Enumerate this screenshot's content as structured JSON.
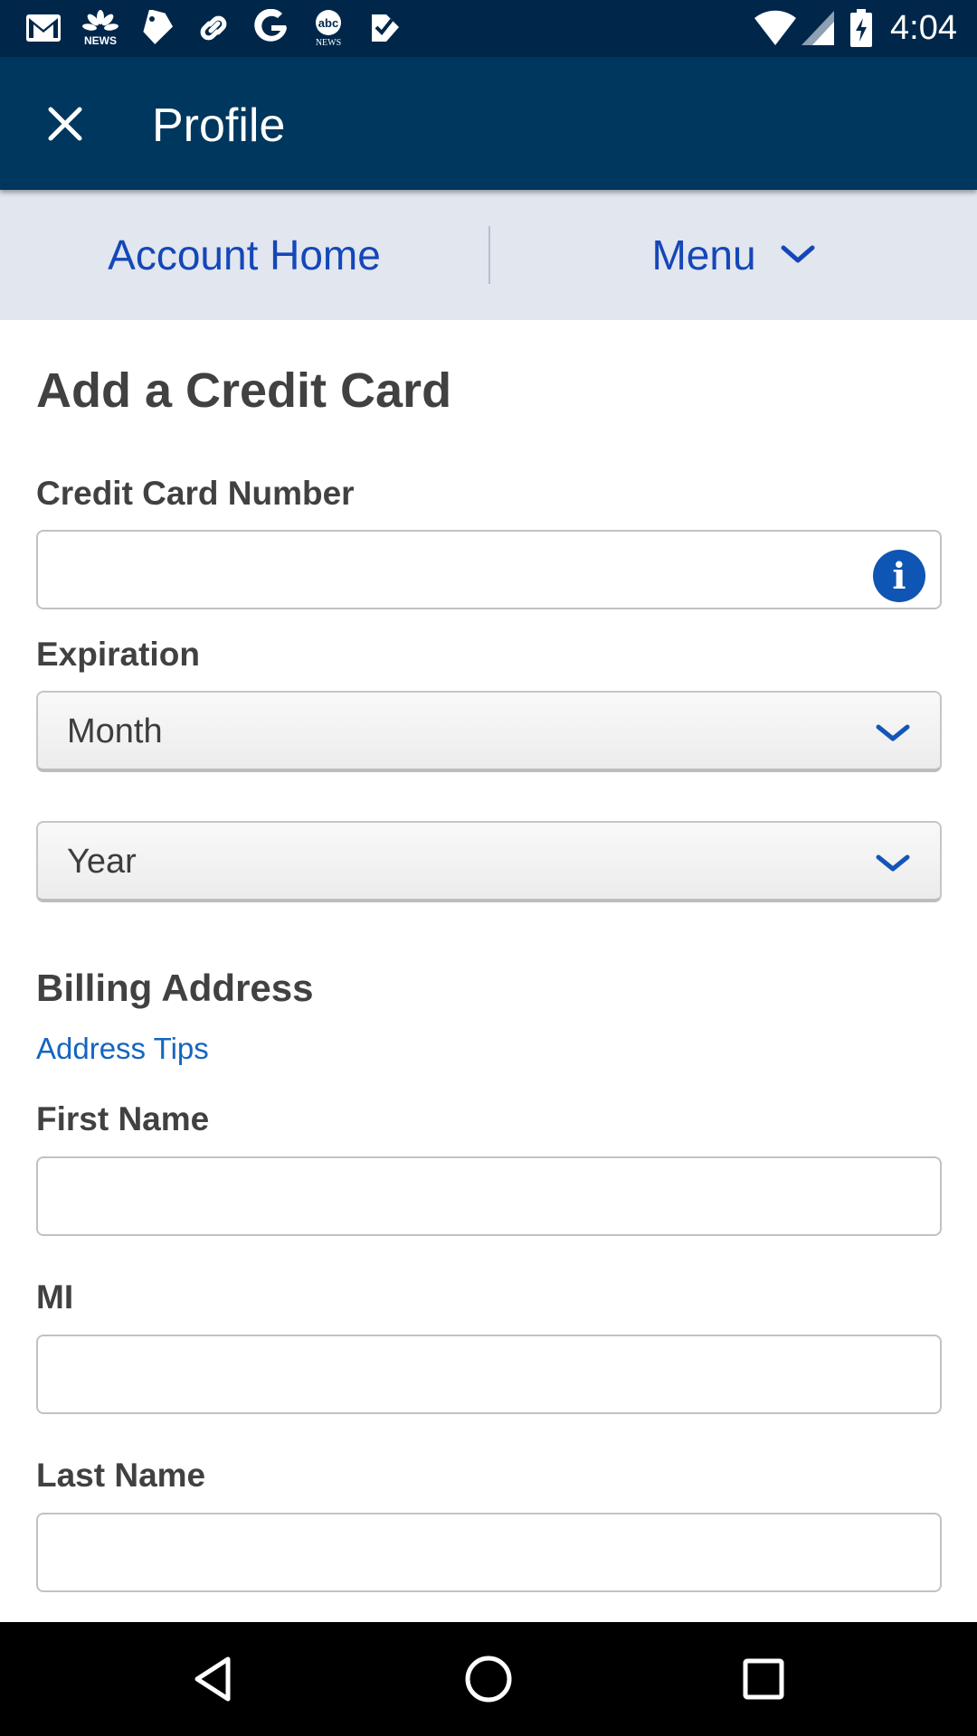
{
  "status_bar": {
    "time": "4:04",
    "notification_icons": [
      "gmail-icon",
      "nbc-news-icon",
      "tag-icon",
      "link-icon",
      "google-icon",
      "abc-news-icon",
      "check-tag-icon"
    ],
    "system_icons": [
      "wifi-icon",
      "signal-icon",
      "battery-charging-icon"
    ]
  },
  "app_bar": {
    "title": "Profile",
    "close_icon": "close-icon",
    "background_color": "#00375f"
  },
  "sub_nav": {
    "account_home": "Account Home",
    "menu": "Menu",
    "link_color": "#1447b8"
  },
  "form": {
    "title": "Add a Credit Card",
    "card_number": {
      "label": "Credit Card Number",
      "value": "",
      "info_icon": "info-icon",
      "info_glyph": "i"
    },
    "expiration": {
      "label": "Expiration",
      "month": {
        "selected": "Month"
      },
      "year": {
        "selected": "Year"
      }
    },
    "billing": {
      "title": "Billing Address",
      "tips_link": "Address Tips",
      "first_name": {
        "label": "First Name",
        "value": ""
      },
      "mi": {
        "label": "MI",
        "value": ""
      },
      "last_name": {
        "label": "Last Name",
        "value": ""
      }
    }
  },
  "nav_bar": {
    "icons": [
      "back-icon",
      "home-icon",
      "recents-icon"
    ]
  }
}
